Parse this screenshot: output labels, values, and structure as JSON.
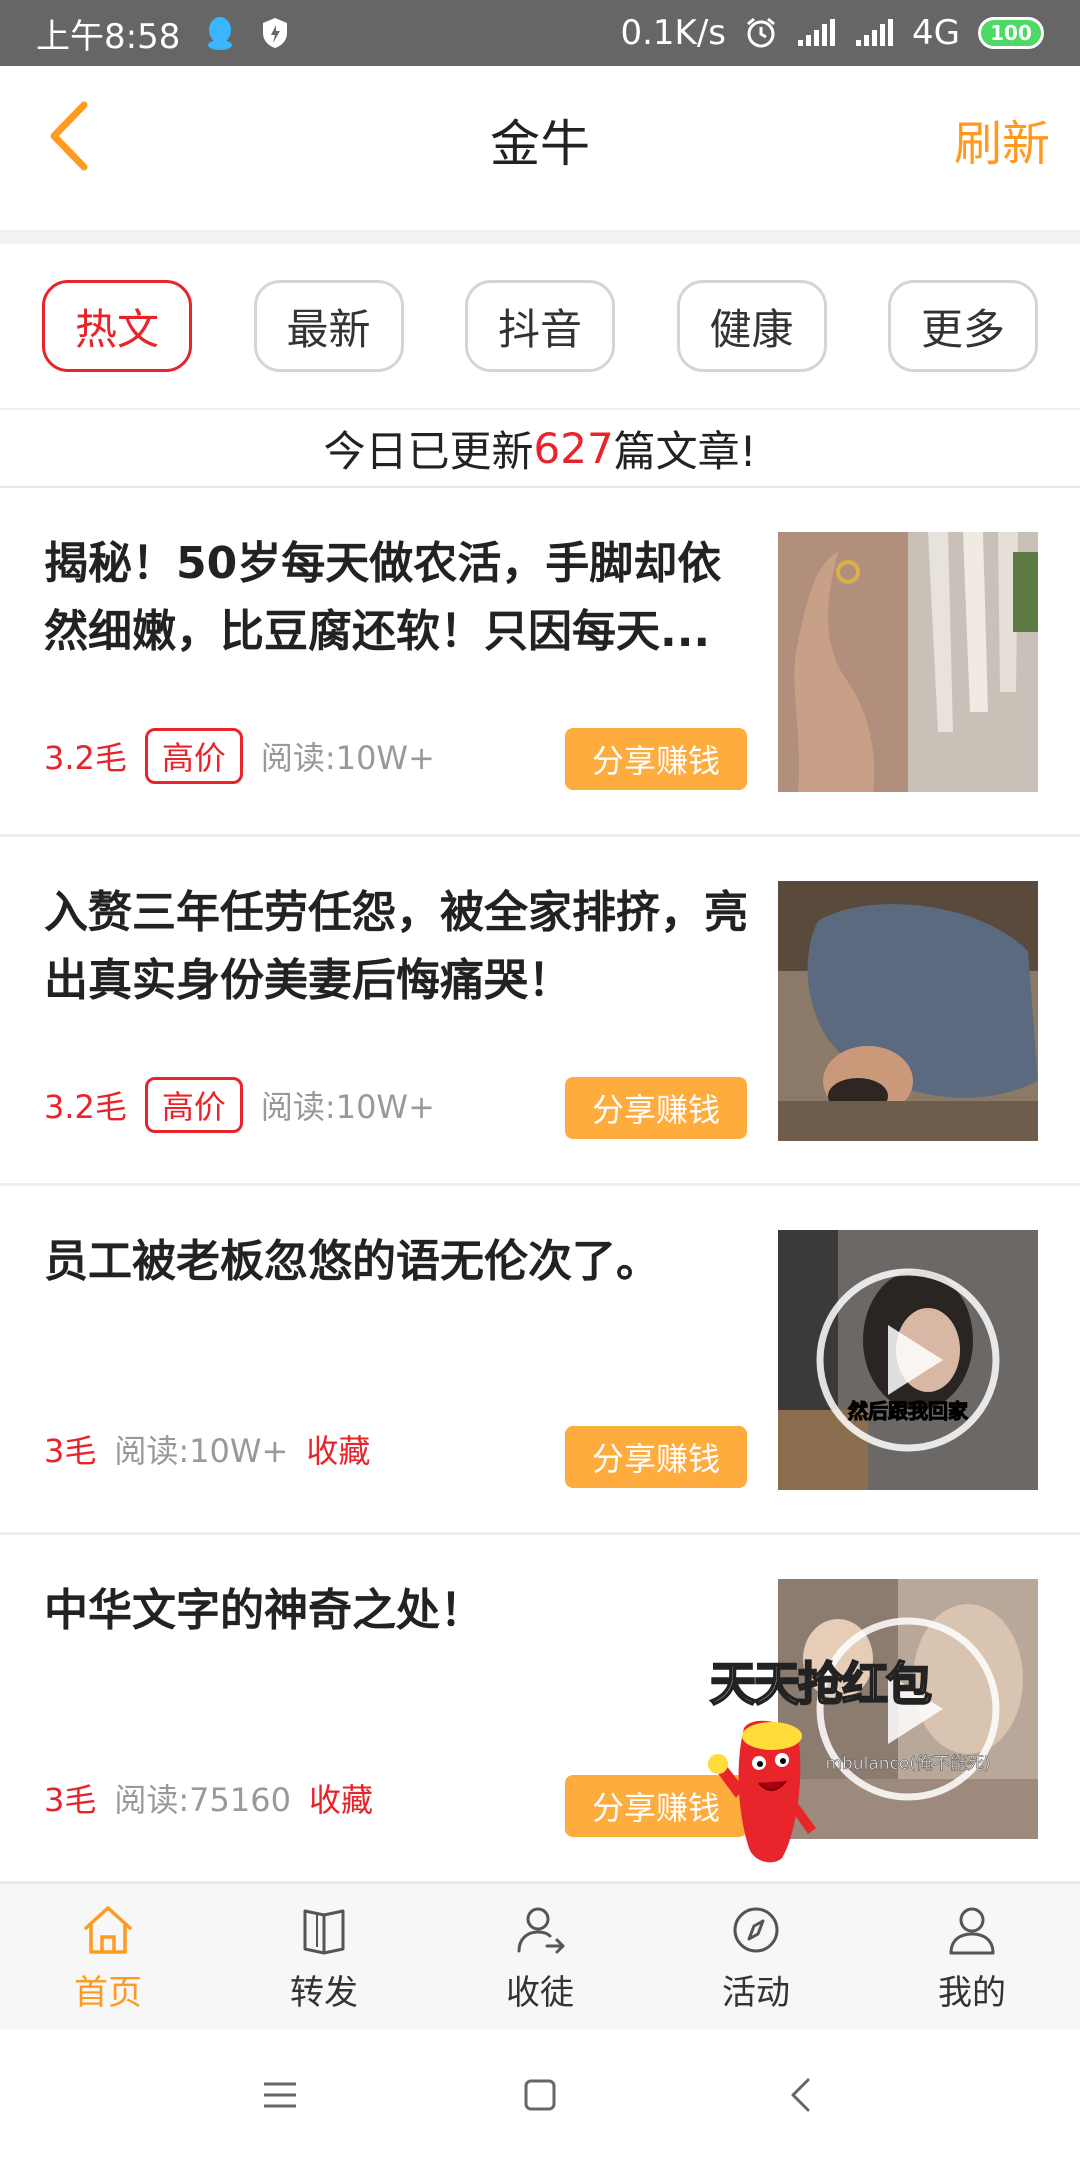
{
  "status_bar": {
    "time": "上午8:58",
    "network_speed": "0.1K/s",
    "network_type": "4G",
    "battery": "100"
  },
  "header": {
    "title": "金牛",
    "refresh_label": "刷新"
  },
  "tabs": [
    {
      "label": "热文",
      "active": true
    },
    {
      "label": "最新",
      "active": false
    },
    {
      "label": "抖音",
      "active": false
    },
    {
      "label": "健康",
      "active": false
    },
    {
      "label": "更多",
      "active": false
    }
  ],
  "notice": {
    "prefix": "今日已更新",
    "count": "627",
    "suffix": "篇文章!"
  },
  "articles": [
    {
      "title": "揭秘！50岁每天做农活，手脚却依然细嫩，比豆腐还软！只因每天...",
      "price": "3.2毛",
      "badge": "高价",
      "reads": "阅读:10W+",
      "collect": "",
      "share": "分享赚钱"
    },
    {
      "title": "入赘三年任劳任怨，被全家排挤，亮出真实身份美妻后悔痛哭！",
      "price": "3.2毛",
      "badge": "高价",
      "reads": "阅读:10W+",
      "collect": "",
      "share": "分享赚钱"
    },
    {
      "title": "员工被老板忽悠的语无伦次了。",
      "price": "3毛",
      "badge": "",
      "reads": "阅读:10W+",
      "collect": "收藏",
      "share": "分享赚钱",
      "thumb_caption": "然后跟我回家"
    },
    {
      "title": "中华文字的神奇之处！",
      "price": "3毛",
      "badge": "",
      "reads": "阅读:75160",
      "collect": "收藏",
      "share": "分享赚钱",
      "thumb_caption": "mbulance(俺不能死)"
    }
  ],
  "promo": {
    "label": "天天抢红包"
  },
  "bottom_nav": [
    {
      "label": "首页",
      "icon": "home-icon",
      "active": true
    },
    {
      "label": "转发",
      "icon": "book-icon",
      "active": false
    },
    {
      "label": "收徒",
      "icon": "user-share-icon",
      "active": false
    },
    {
      "label": "活动",
      "icon": "compass-icon",
      "active": false
    },
    {
      "label": "我的",
      "icon": "user-icon",
      "active": false
    }
  ],
  "colors": {
    "accent_orange": "#ff9a1f",
    "accent_red": "#e8242a",
    "share_button": "#ffac3e"
  }
}
